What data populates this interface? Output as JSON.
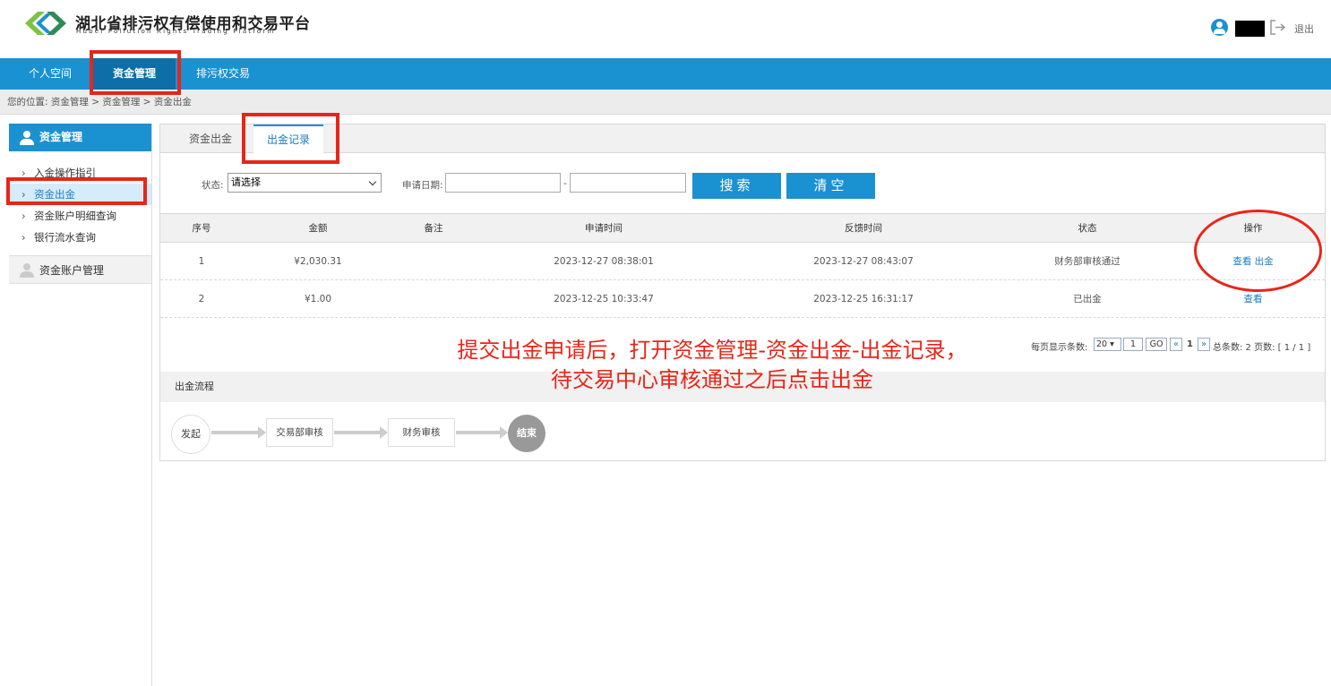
{
  "header": {
    "title": "湖北省排污权有偿使用和交易平台",
    "subtitle": "Hubei Pollution Rights Trading Platform",
    "logout": "退出"
  },
  "nav": [
    {
      "label": "个人空间"
    },
    {
      "label": "资金管理",
      "active": true
    },
    {
      "label": "排污权交易"
    }
  ],
  "breadcrumb": "您的位置:  资金管理 > 资金管理 > 资金出金",
  "sidebar": {
    "header": "资金管理",
    "items": [
      {
        "label": "入金操作指引"
      },
      {
        "label": "资金出金",
        "active": true
      },
      {
        "label": "资金账户明细查询"
      },
      {
        "label": "银行流水查询"
      }
    ],
    "group": "资金账户管理"
  },
  "tabs": [
    {
      "label": "资金出金"
    },
    {
      "label": "出金记录",
      "active": true
    }
  ],
  "filter": {
    "status_label": "状态:",
    "status_value": "请选择",
    "date_label": "申请日期:",
    "date_sep": "-",
    "search_button": "搜索",
    "clear_button": "清空"
  },
  "table": {
    "headers": [
      "序号",
      "金额",
      "备注",
      "申请时间",
      "反馈时间",
      "状态",
      "操作"
    ],
    "rows": [
      {
        "no": "1",
        "amount": "¥2,030.31",
        "remark": "",
        "apply_time": "2023-12-27 08:38:01",
        "feedback_time": "2023-12-27 08:43:07",
        "status": "财务部审核通过",
        "op_view": "查看",
        "op_withdraw": "出金"
      },
      {
        "no": "2",
        "amount": "¥1.00",
        "remark": "",
        "apply_time": "2023-12-25 10:33:47",
        "feedback_time": "2023-12-25 16:31:17",
        "status": "已出金",
        "op_view": "查看",
        "op_withdraw": ""
      }
    ]
  },
  "pager": {
    "per_page_label": "每页显示条数:",
    "per_page": "20",
    "page_input": "1",
    "go": "GO",
    "prev": "«",
    "current": "1",
    "next": "»",
    "summary": "总条数: 2 页数: [ 1 / 1 ]"
  },
  "flow": {
    "title": "出金流程",
    "steps": [
      "发起",
      "交易部审核",
      "财务审核",
      "结束"
    ]
  },
  "annotation": {
    "line1": "提交出金申请后，打开资金管理-资金出金-出金记录，",
    "line2": "待交易中心审核通过之后点击出金",
    "color": "#e8251a"
  },
  "colors": {
    "brand": "#1a91d1",
    "brand_dark": "#0d6ea8",
    "link": "#1a7bbf"
  }
}
